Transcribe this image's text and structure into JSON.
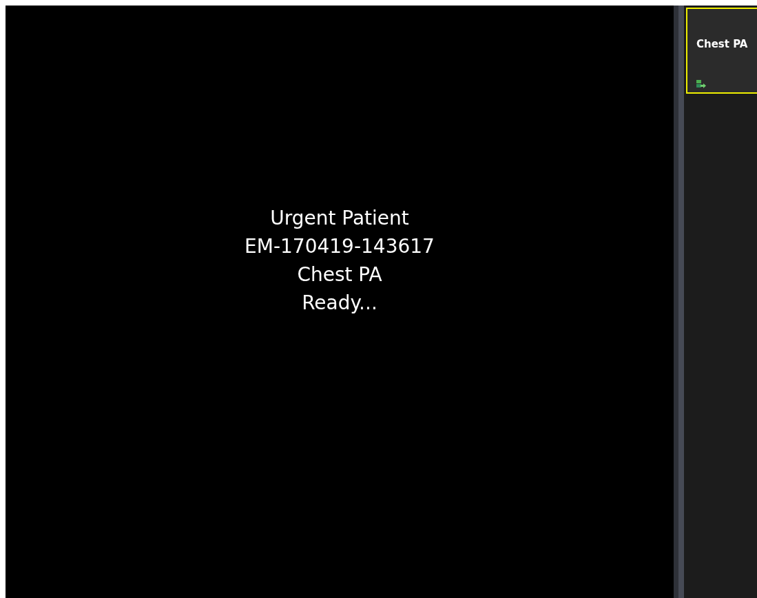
{
  "viewer": {
    "lines": [
      "Urgent Patient",
      "EM-170419-143617",
      "Chest PA",
      "Ready..."
    ]
  },
  "thumbnails": [
    {
      "label": "Chest PA",
      "selected": true
    }
  ]
}
